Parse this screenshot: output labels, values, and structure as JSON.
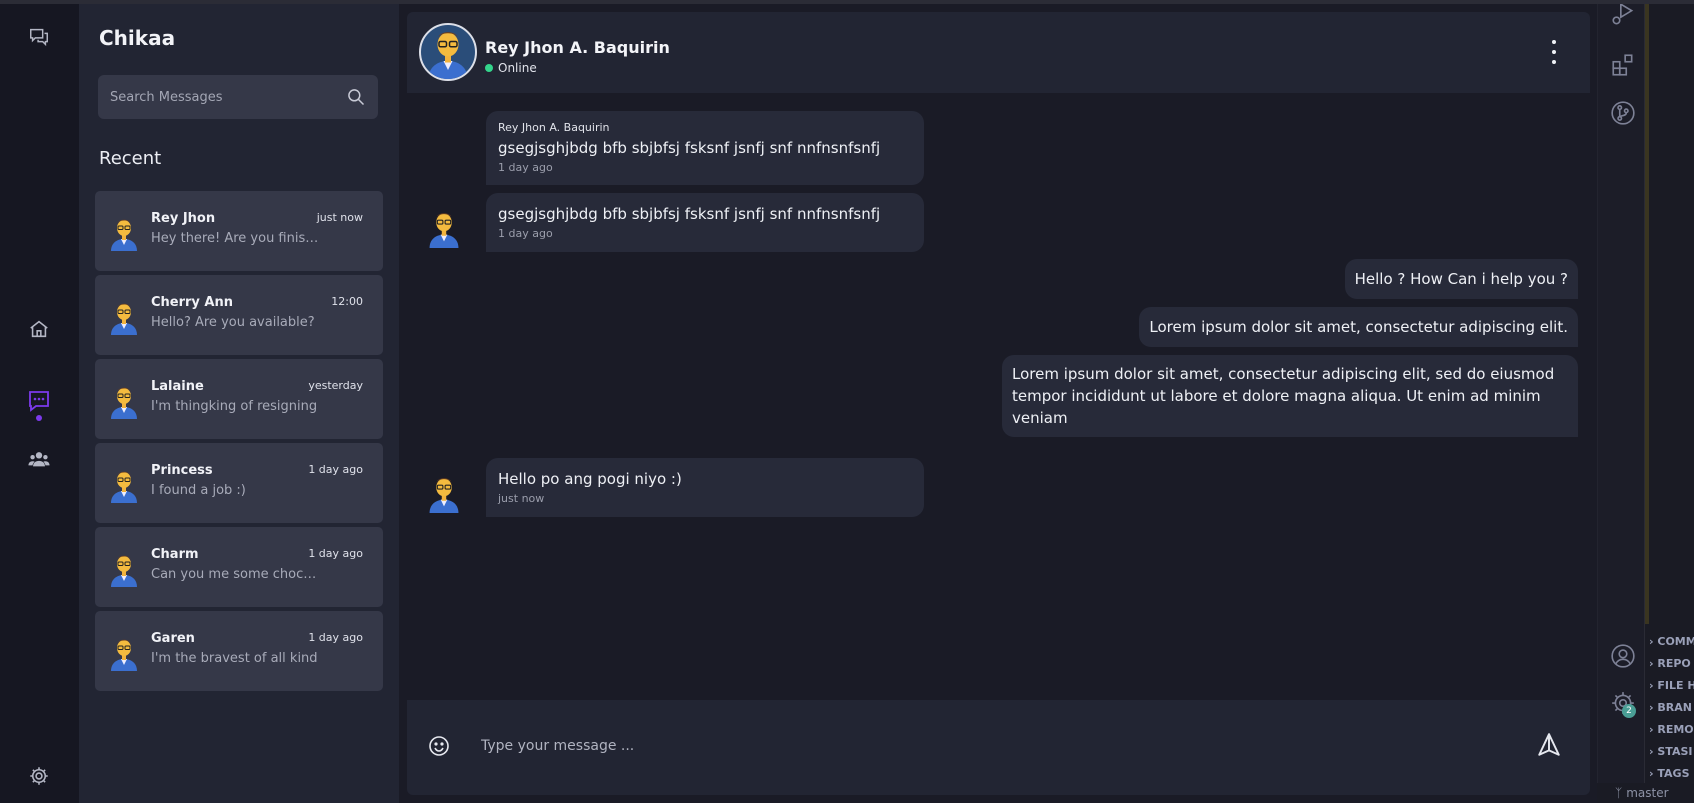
{
  "app": {
    "name": "Chikaa"
  },
  "search": {
    "placeholder": "Search Messages"
  },
  "sidebar": {
    "recent_label": "Recent"
  },
  "conversations": [
    {
      "name": "Rey Jhon",
      "time": "just now",
      "preview": "Hey there! Are you finished?"
    },
    {
      "name": "Cherry Ann",
      "time": "12:00",
      "preview": "Hello? Are you available?"
    },
    {
      "name": "Lalaine",
      "time": "yesterday",
      "preview": "I'm thingking of resigning"
    },
    {
      "name": "Princess",
      "time": "1 day ago",
      "preview": "I found a job :)"
    },
    {
      "name": "Charm",
      "time": "1 day ago",
      "preview": "Can you me some chocolates"
    },
    {
      "name": "Garen",
      "time": "1 day ago",
      "preview": "I'm the bravest of all kind"
    }
  ],
  "chat": {
    "contact_name": "Rey Jhon A. Baquirin",
    "status": "Online",
    "messages": [
      {
        "direction": "in",
        "sender": "Rey Jhon A. Baquirin",
        "text": "gsegjsghjbdg bfb sbjbfsj fsksnf jsnfj snf nnfnsnfsnfj",
        "time": "1 day ago"
      },
      {
        "direction": "in",
        "sender": "",
        "text": "gsegjsghjbdg bfb sbjbfsj fsksnf jsnfj snf nnfnsnfsnfj",
        "time": "1 day ago"
      },
      {
        "direction": "out",
        "text": "Hello ? How Can i help you ?"
      },
      {
        "direction": "out",
        "text": "Lorem ipsum dolor sit amet, consectetur adipiscing elit."
      },
      {
        "direction": "out",
        "text": "Lorem ipsum dolor sit amet, consectetur adipiscing elit, sed do eiusmod tempor incididunt ut labore et dolore magna aliqua. Ut enim ad minim veniam"
      },
      {
        "direction": "in",
        "sender": "",
        "text": "Hello po ang pogi niyo :)",
        "time": "just now"
      }
    ]
  },
  "composer": {
    "placeholder": "Type your message ..."
  },
  "vscode": {
    "badge": "2",
    "panel_items": [
      "COMM",
      "REPO",
      "FILE H",
      "BRAN",
      "REMO",
      "STASI",
      "TAGS"
    ],
    "branch": "master"
  },
  "colors": {
    "accent": "#7c3aed",
    "online": "#34d58c",
    "sidebar_bg": "#222533",
    "card_bg": "#353848"
  }
}
